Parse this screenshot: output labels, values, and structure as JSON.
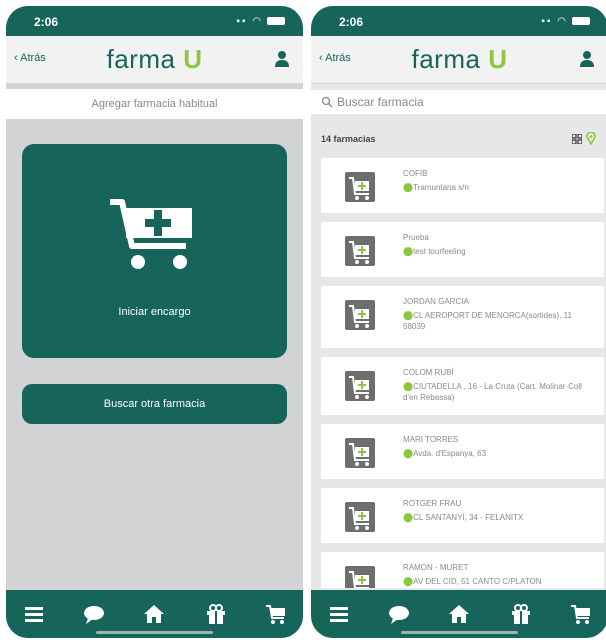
{
  "left": {
    "status": {
      "time": "2:06"
    },
    "nav": {
      "back_label": "Atrás",
      "logo_main": "farma",
      "logo_accent": "U"
    },
    "habitual_label": "Agregar farmacia habitual",
    "encargo_label": "Iniciar encargo",
    "buscar_label": "Buscar otra farmacia"
  },
  "right": {
    "status": {
      "time": "2:06"
    },
    "nav": {
      "back_label": "Atrás",
      "logo_main": "farma",
      "logo_accent": "U"
    },
    "search_placeholder": "Buscar farmacia",
    "count_label": "14 farmacias",
    "pharmacies": [
      {
        "name": "COFIB",
        "address": "Tramuntana s/n"
      },
      {
        "name": "Prueba",
        "address": "test tourfeeling"
      },
      {
        "name": "JORDAN GARCIA",
        "address": "CL AEROPORT DE MENORCA(sortides), 11 58039"
      },
      {
        "name": "COLOM RUBÍ",
        "address": "CIUTADELLA , 16 - La Cruta (Cart. Molinar-Coll d'en Rebassa)"
      },
      {
        "name": "MARI TORRES",
        "address": "Avda. d'Espanya, 63"
      },
      {
        "name": "ROTGER FRAU",
        "address": "CL SANTANYÍ, 34 - FELANITX"
      },
      {
        "name": "RAMON - MURET",
        "address": "AV DEL CID, 51 CANTO C/PLATON"
      }
    ]
  },
  "colors": {
    "brand": "#17645b",
    "accent": "#8dc63f"
  },
  "tabs": [
    "menu-icon",
    "chat-icon",
    "home-icon",
    "gift-icon",
    "cart-icon"
  ]
}
